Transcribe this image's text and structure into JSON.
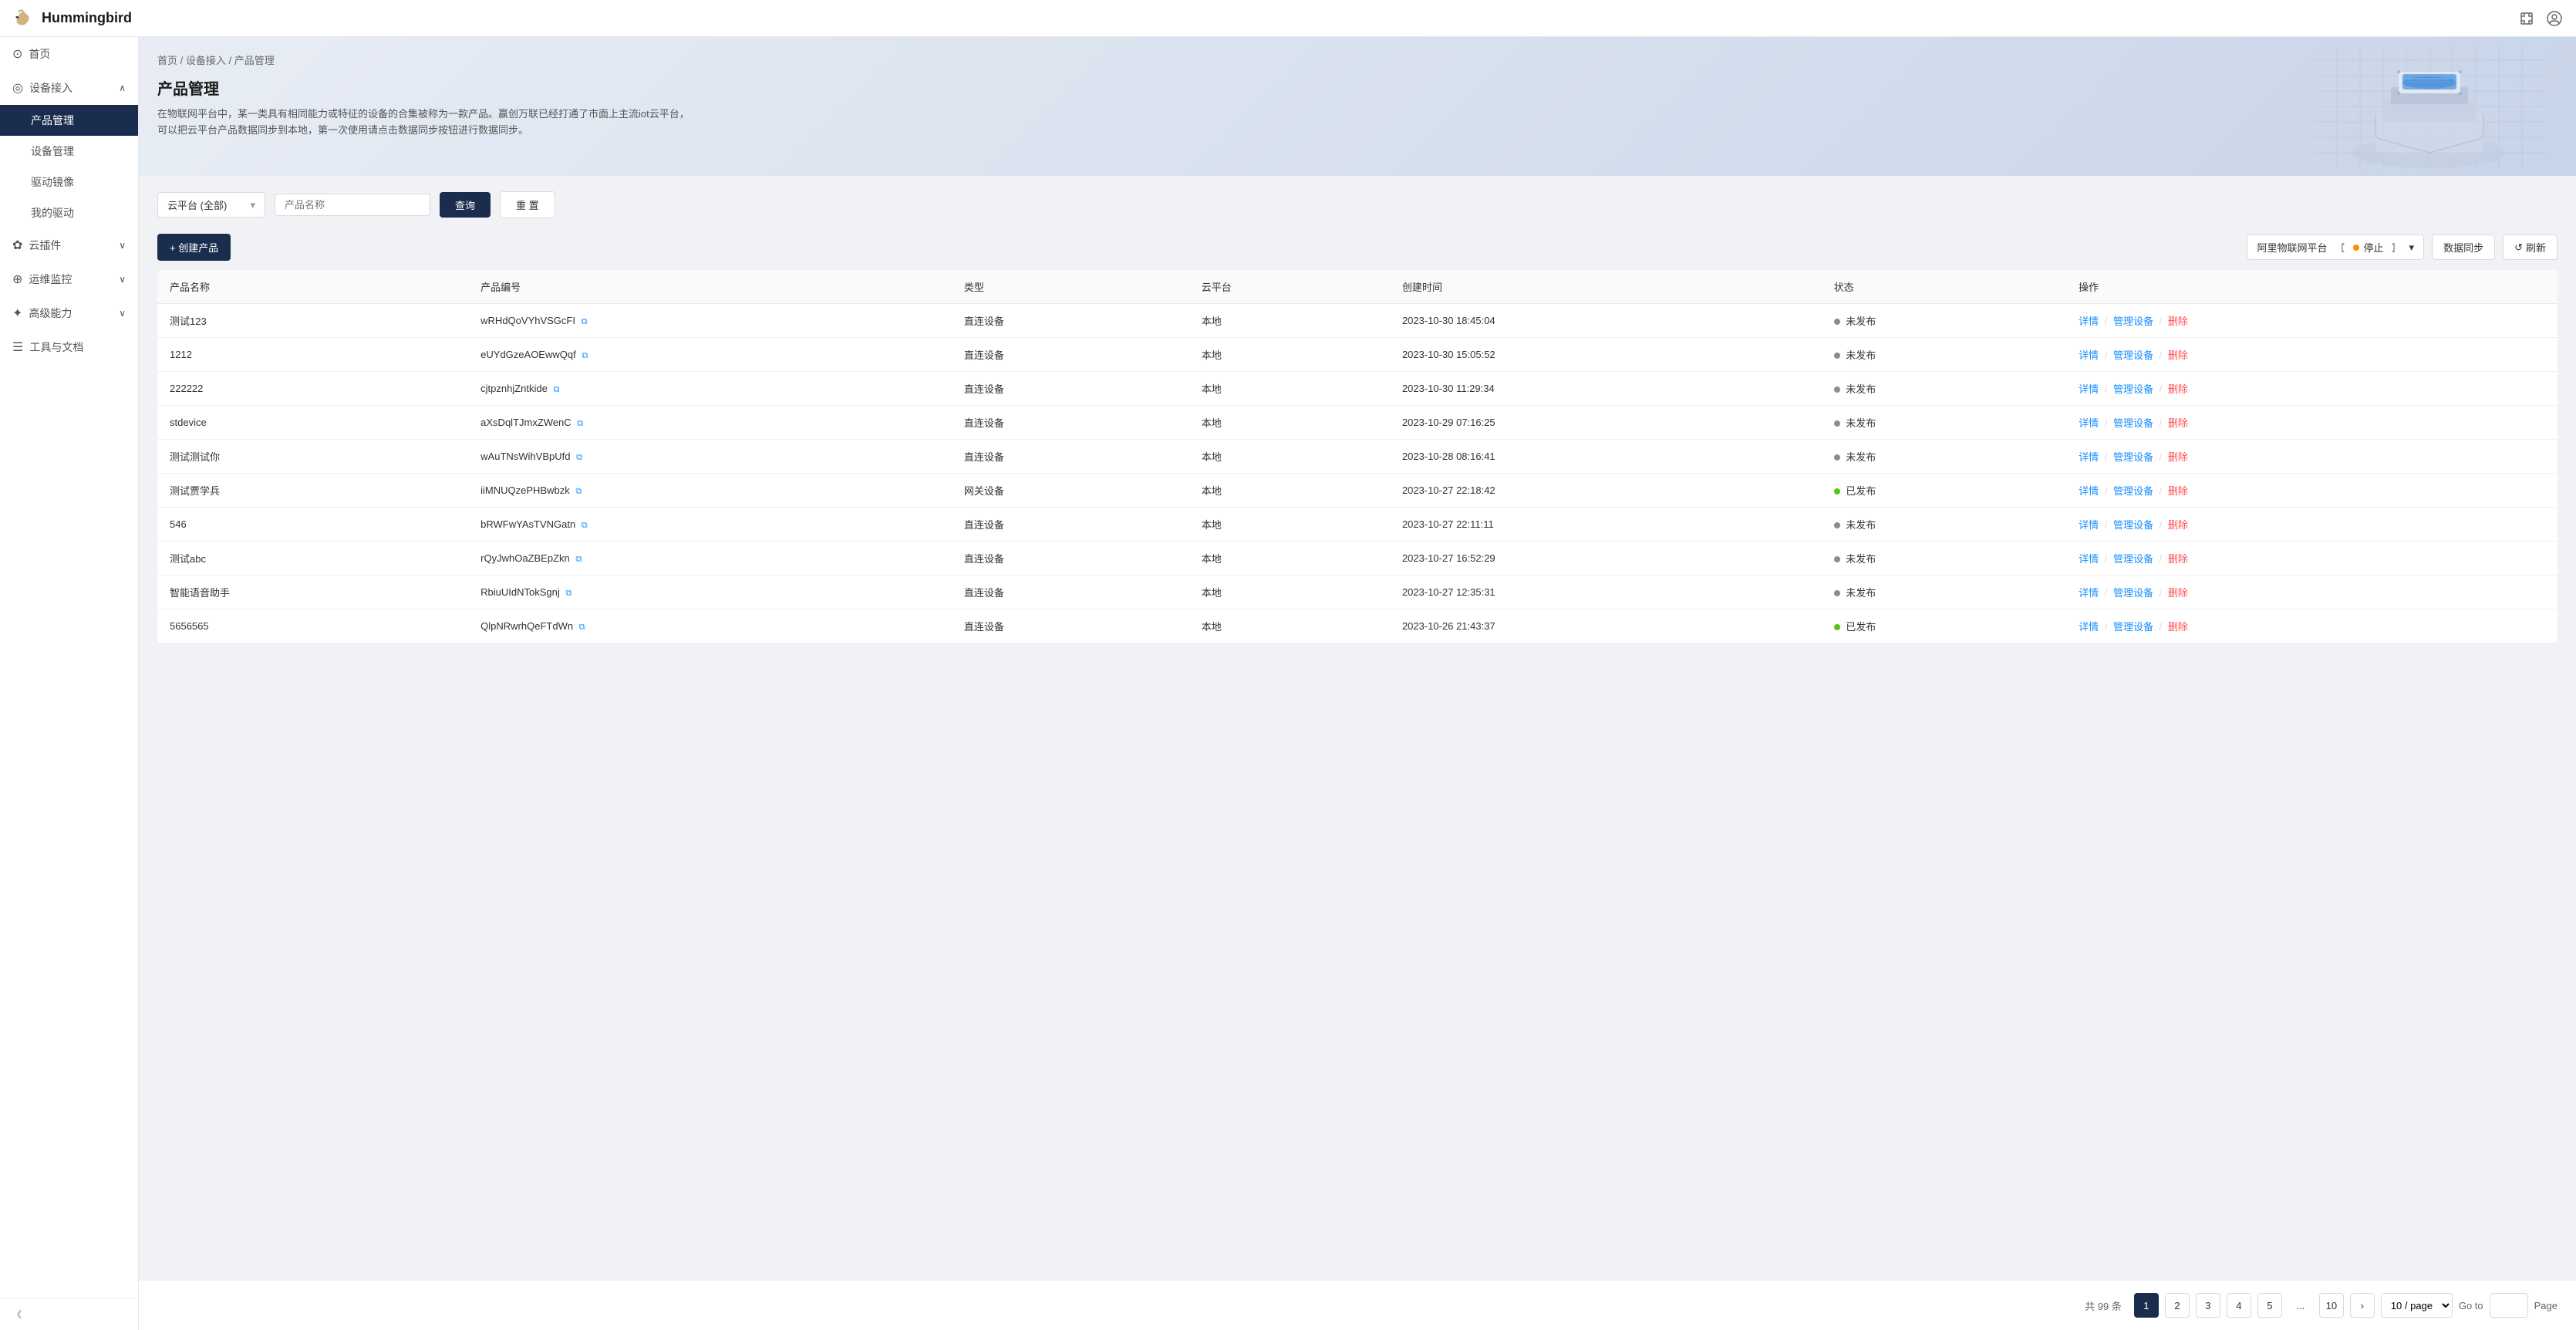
{
  "header": {
    "title": "Hummingbird",
    "logo_alt": "hummingbird-logo"
  },
  "sidebar": {
    "items": [
      {
        "id": "home",
        "label": "首页",
        "icon": "⊙",
        "active": false,
        "sub": []
      },
      {
        "id": "device-access",
        "label": "设备接入",
        "icon": "◎",
        "active": true,
        "expanded": true,
        "sub": [
          {
            "id": "product-management",
            "label": "产品管理",
            "active": true
          },
          {
            "id": "device-management",
            "label": "设备管理",
            "active": false
          },
          {
            "id": "driver-image",
            "label": "驱动镜像",
            "active": false
          },
          {
            "id": "my-driver",
            "label": "我的驱动",
            "active": false
          }
        ]
      },
      {
        "id": "cloud-plugin",
        "label": "云插件",
        "icon": "✿",
        "active": false,
        "sub": []
      },
      {
        "id": "ops-monitor",
        "label": "运维监控",
        "icon": "⊕",
        "active": false,
        "sub": []
      },
      {
        "id": "advanced",
        "label": "高级能力",
        "icon": "✦",
        "active": false,
        "sub": []
      },
      {
        "id": "tools-docs",
        "label": "工具与文档",
        "icon": "☰",
        "active": false,
        "sub": []
      }
    ],
    "collapse_label": "《"
  },
  "breadcrumb": {
    "items": [
      "首页",
      "设备接入",
      "产品管理"
    ],
    "separator": "/"
  },
  "banner": {
    "title": "产品管理",
    "description": "在物联网平台中，某一类具有相同能力或特征的设备的合集被称为一款产品。赢创万联已经打通了市面上主流iot云平台，可以把云平台产品数据同步到本地，第一次使用请点击数据同步按钮进行数据同步。"
  },
  "filter": {
    "platform_label": "云平台 (全部)",
    "platform_placeholder": "云平台 (全部)",
    "product_placeholder": "产品名称",
    "search_btn": "查询",
    "reset_btn": "重 置"
  },
  "toolbar": {
    "create_btn": "+ 创建产品",
    "platform_btn_label": "阿里物联网平台",
    "platform_status": "停止",
    "sync_btn": "数据同步",
    "refresh_icon": "↺",
    "refresh_btn": "刷新"
  },
  "table": {
    "columns": [
      "产品名称",
      "产品编号",
      "类型",
      "云平台",
      "创建时间",
      "状态",
      "操作"
    ],
    "rows": [
      {
        "name": "测试123",
        "code": "wRHdQoVYhVSGcFI",
        "type": "直连设备",
        "platform": "本地",
        "created": "2023-10-30 18:45:04",
        "status": "未发布",
        "published": false
      },
      {
        "name": "1212",
        "code": "eUYdGzeAOEwwQqf",
        "type": "直连设备",
        "platform": "本地",
        "created": "2023-10-30 15:05:52",
        "status": "未发布",
        "published": false
      },
      {
        "name": "222222",
        "code": "cjtpznhjZntkide",
        "type": "直连设备",
        "platform": "本地",
        "created": "2023-10-30 11:29:34",
        "status": "未发布",
        "published": false
      },
      {
        "name": "stdevice",
        "code": "aXsDqlTJmxZWenC",
        "type": "直连设备",
        "platform": "本地",
        "created": "2023-10-29 07:16:25",
        "status": "未发布",
        "published": false
      },
      {
        "name": "测试测试你",
        "code": "wAuTNsWihVBpUfd",
        "type": "直连设备",
        "platform": "本地",
        "created": "2023-10-28 08:16:41",
        "status": "未发布",
        "published": false
      },
      {
        "name": "测试贾学兵",
        "code": "iiMNUQzePHBwbzk",
        "type": "网关设备",
        "platform": "本地",
        "created": "2023-10-27 22:18:42",
        "status": "已发布",
        "published": true
      },
      {
        "name": "546",
        "code": "bRWFwYAsTVNGatn",
        "type": "直连设备",
        "platform": "本地",
        "created": "2023-10-27 22:11:11",
        "status": "未发布",
        "published": false
      },
      {
        "name": "测试abc",
        "code": "rQyJwhOaZBEpZkn",
        "type": "直连设备",
        "platform": "本地",
        "created": "2023-10-27 16:52:29",
        "status": "未发布",
        "published": false
      },
      {
        "name": "智能语音助手",
        "code": "RbiuUIdNTokSgnj",
        "type": "直连设备",
        "platform": "本地",
        "created": "2023-10-27 12:35:31",
        "status": "未发布",
        "published": false
      },
      {
        "name": "5656565",
        "code": "QlpNRwrhQeFTdWn",
        "type": "直连设备",
        "platform": "本地",
        "created": "2023-10-26 21:43:37",
        "status": "已发布",
        "published": true
      }
    ],
    "actions": {
      "detail": "详情",
      "manage": "管理设备",
      "delete": "删除"
    }
  },
  "pagination": {
    "total_label": "共 99 条",
    "pages": [
      "1",
      "2",
      "3",
      "4",
      "5"
    ],
    "ellipsis": "...",
    "next_label": ">",
    "page_size": "10 / page",
    "goto_label": "Go to",
    "page_label": "Page",
    "current": "1"
  }
}
